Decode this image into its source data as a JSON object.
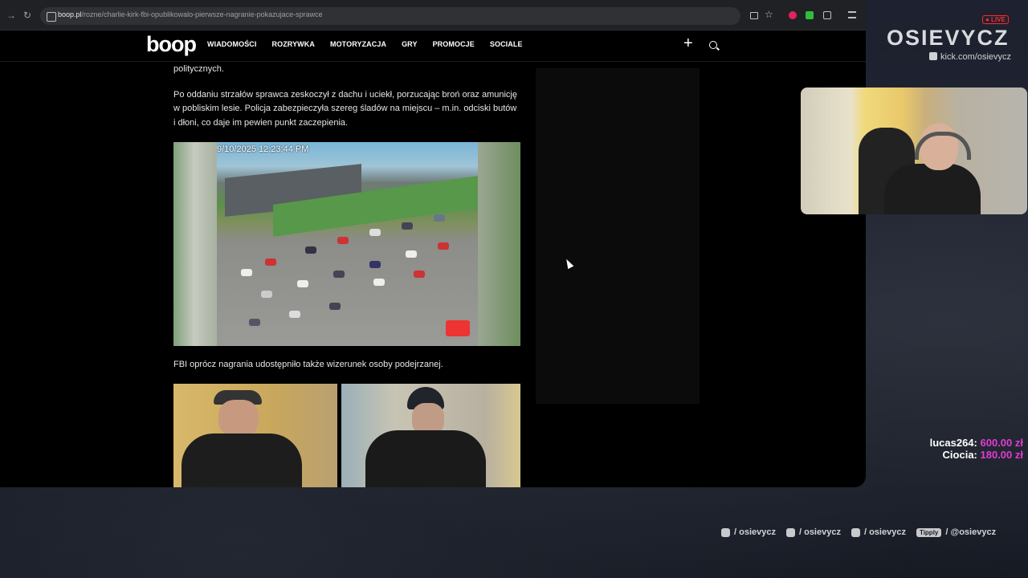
{
  "browser": {
    "url_domain": "boop.pl",
    "url_path": "/rozne/charlie-kirk-fbi-opublikowalo-pierwsze-nagranie-pokazujace-sprawce"
  },
  "site": {
    "logo": "boop",
    "menu": [
      "WIADOMOŚCI",
      "ROZRYWKA",
      "MOTORYZACJA",
      "GRY",
      "PROMOCJE",
      "SOCIALE"
    ]
  },
  "article": {
    "p1_tail": "politycznych.",
    "p2": "Po oddaniu strzałów sprawca zeskoczył z dachu i uciekł, porzucając broń oraz amunicję w pobliskim lesie. Policja zabezpieczyła szereg śladów na miejscu – m.in. odciski butów i dłoni, co daje im pewien punkt zaczepienia.",
    "cctv_timestamp": "9/10/2025 12:23:44 PM",
    "p3": "FBI oprócz nagrania udostępniło także wizerunek osoby podejrzanej."
  },
  "overlay": {
    "live_badge": "● LIVE",
    "brand": "OSIEVYCZ",
    "kick_url": "kick.com/osievycz",
    "donations": [
      {
        "user": "lucas264:",
        "amount": "600.00 zł"
      },
      {
        "user": "Ciocia:",
        "amount": "180.00 zł"
      }
    ],
    "socials": [
      {
        "icon": "instagram-icon",
        "label": "/ osievycz"
      },
      {
        "icon": "tiktok-icon",
        "label": "/ osievycz"
      },
      {
        "icon": "youtube-icon",
        "label": "/ osievycz"
      },
      {
        "icon": "tipply-icon",
        "badge": "Tipply",
        "label": "/ @osievycz"
      }
    ]
  }
}
